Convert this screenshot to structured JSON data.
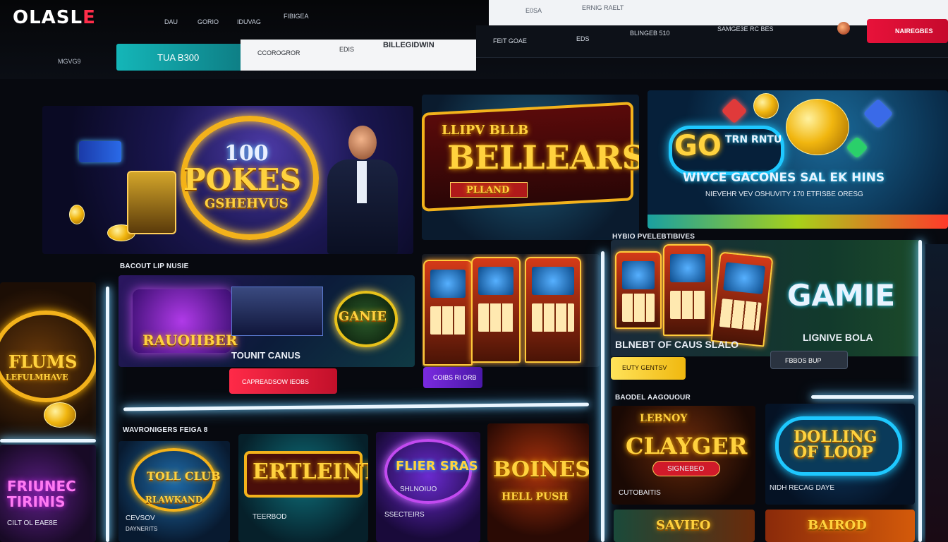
{
  "header": {
    "logo_text": "OLASL",
    "logo_accent": "E",
    "side_label": "MGVG9",
    "nav": [
      "DAU",
      "GORIO",
      "IDUVAG",
      "FIBIGEA"
    ],
    "search_panel": [
      "E0SA",
      "ERNIG RAELT"
    ],
    "tabs": {
      "active": "TUA B300",
      "items": [
        "CCOROGROR",
        "EDIS",
        "BILLEGIDWIN"
      ]
    },
    "secondary_nav": [
      "FEIT GOAE",
      "EDS",
      "BLINGEB 510",
      "SAMGE3E RC BES"
    ],
    "cta_label": "NAIREGBES"
  },
  "banners": {
    "poker": {
      "number": "100",
      "title": "POKES",
      "subtitle": "GSHEHVUS"
    },
    "bells": {
      "top": "LLIPV BLLB",
      "title": "BELLEARS",
      "ribbon": "PLLAND"
    },
    "coins": {
      "badge": "GO",
      "badge_sub": "TRN RNTU",
      "headline": "WIVCE GACONES SAL EK HINS",
      "sub": "NIEVEHR VEV OSHUVITY 170 ETFISBE ORESG"
    }
  },
  "sections": {
    "left_card": {
      "title": "FLUMS",
      "sub": "LEFULMHAVE"
    },
    "left_bottom": {
      "title": "FRIUNEC TIRINIS",
      "sub": "CILT OL EAE8E"
    },
    "poker_room": {
      "label": "BACOUT LIP NUSIE",
      "title": "RAUOIIBER",
      "caption": "TOUNIT CANUS",
      "badge": "GANIE"
    },
    "red_cta": "CAPREADSOW IEOBS",
    "slots": {
      "pill": "COIBS RI ORB"
    },
    "game": {
      "label": "HYBIO PVELEBTIBIVES",
      "title": "GAMIE",
      "caption": "BLNEBT OF CAUS SLALO",
      "sub": "LIGNIVE BOLA"
    },
    "yellow_btn": "EUTY GENTSV",
    "grey_btn": "FBBOS BUP",
    "popular_label": "BAODEL AAGOUOUR",
    "recommended_label": "WAVRONIGERS FEIGA 8"
  },
  "tiles": [
    {
      "title": "TOLL CLUB",
      "sub": "RLAWKAND",
      "caption": "CEVSOV",
      "caption2": "DAYNERITS"
    },
    {
      "title": "ERTLEINT",
      "caption": "TEERBOD"
    },
    {
      "title": "FLIER SRAS",
      "sub": "SHLNOIUO",
      "caption": "SSECTEIRS"
    },
    {
      "title": "BOINES",
      "sub": "HELL PUSH"
    },
    {
      "title": "CLAYGER",
      "top": "LEBNOY",
      "sub": "SIGNEBEO",
      "caption": "CUTOBAITIS"
    },
    {
      "title": "DOLLING OF LOOP",
      "caption": "NIDH RECAG DAYE"
    }
  ],
  "bottom_row": [
    "SAVIEO",
    "BAIROD"
  ]
}
